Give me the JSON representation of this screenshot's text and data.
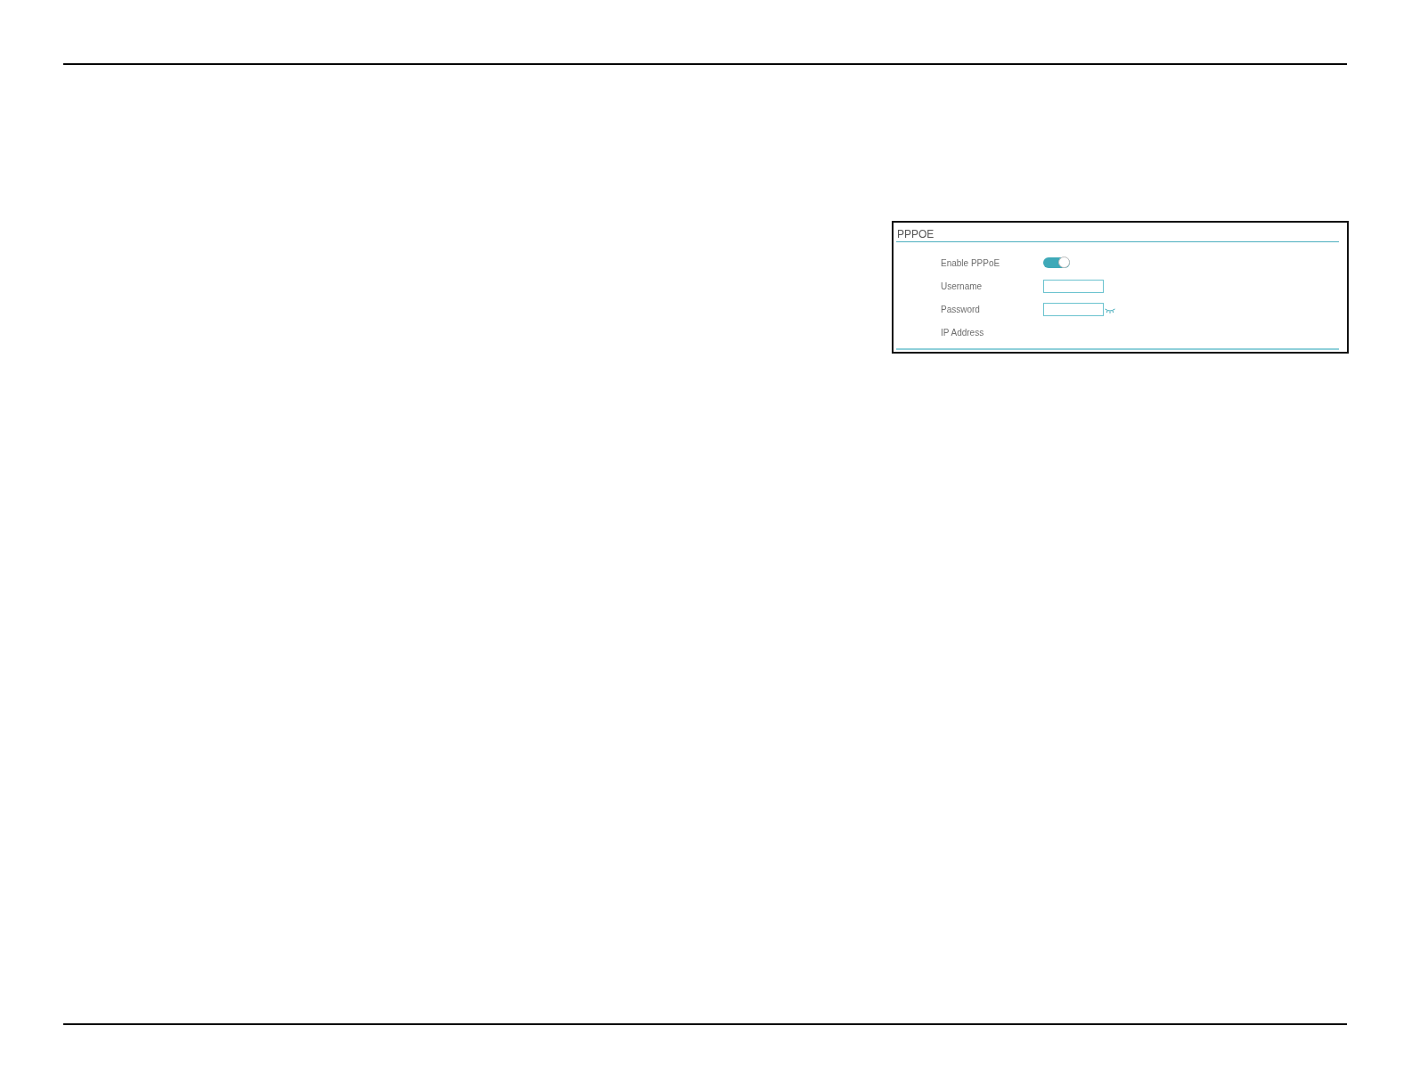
{
  "panel": {
    "title": "PPPOE",
    "fields": [
      {
        "kind": "toggle",
        "label": "Enable PPPoE",
        "on": true
      },
      {
        "kind": "text",
        "label": "Username"
      },
      {
        "kind": "password",
        "label": "Password"
      },
      {
        "kind": "static",
        "label": "IP Address"
      }
    ]
  }
}
